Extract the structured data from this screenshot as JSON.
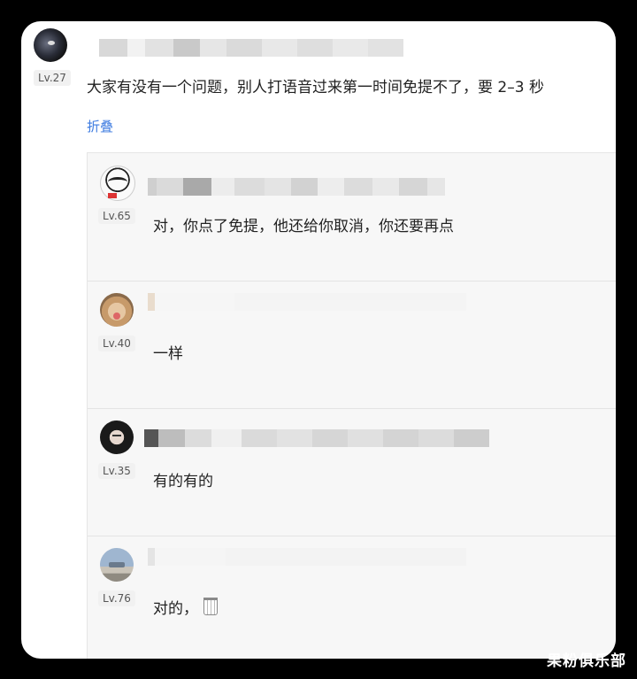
{
  "post": {
    "level": "Lv.27",
    "text": "大家有没有一个问题，别人打语音过来第一时间免提不了，要 2–3 秒",
    "fold_label": "折叠"
  },
  "replies": [
    {
      "level": "Lv.65",
      "text": "对，你点了免提，他还给你取消，你还要再点"
    },
    {
      "level": "Lv.40",
      "text": "一样"
    },
    {
      "level": "Lv.35",
      "text": "有的有的"
    },
    {
      "level": "Lv.76",
      "text": "对的，"
    }
  ],
  "watermark": "果粉俱乐部",
  "colors": {
    "link": "#3d7be0",
    "reply_bg": "#f7f7f7"
  }
}
